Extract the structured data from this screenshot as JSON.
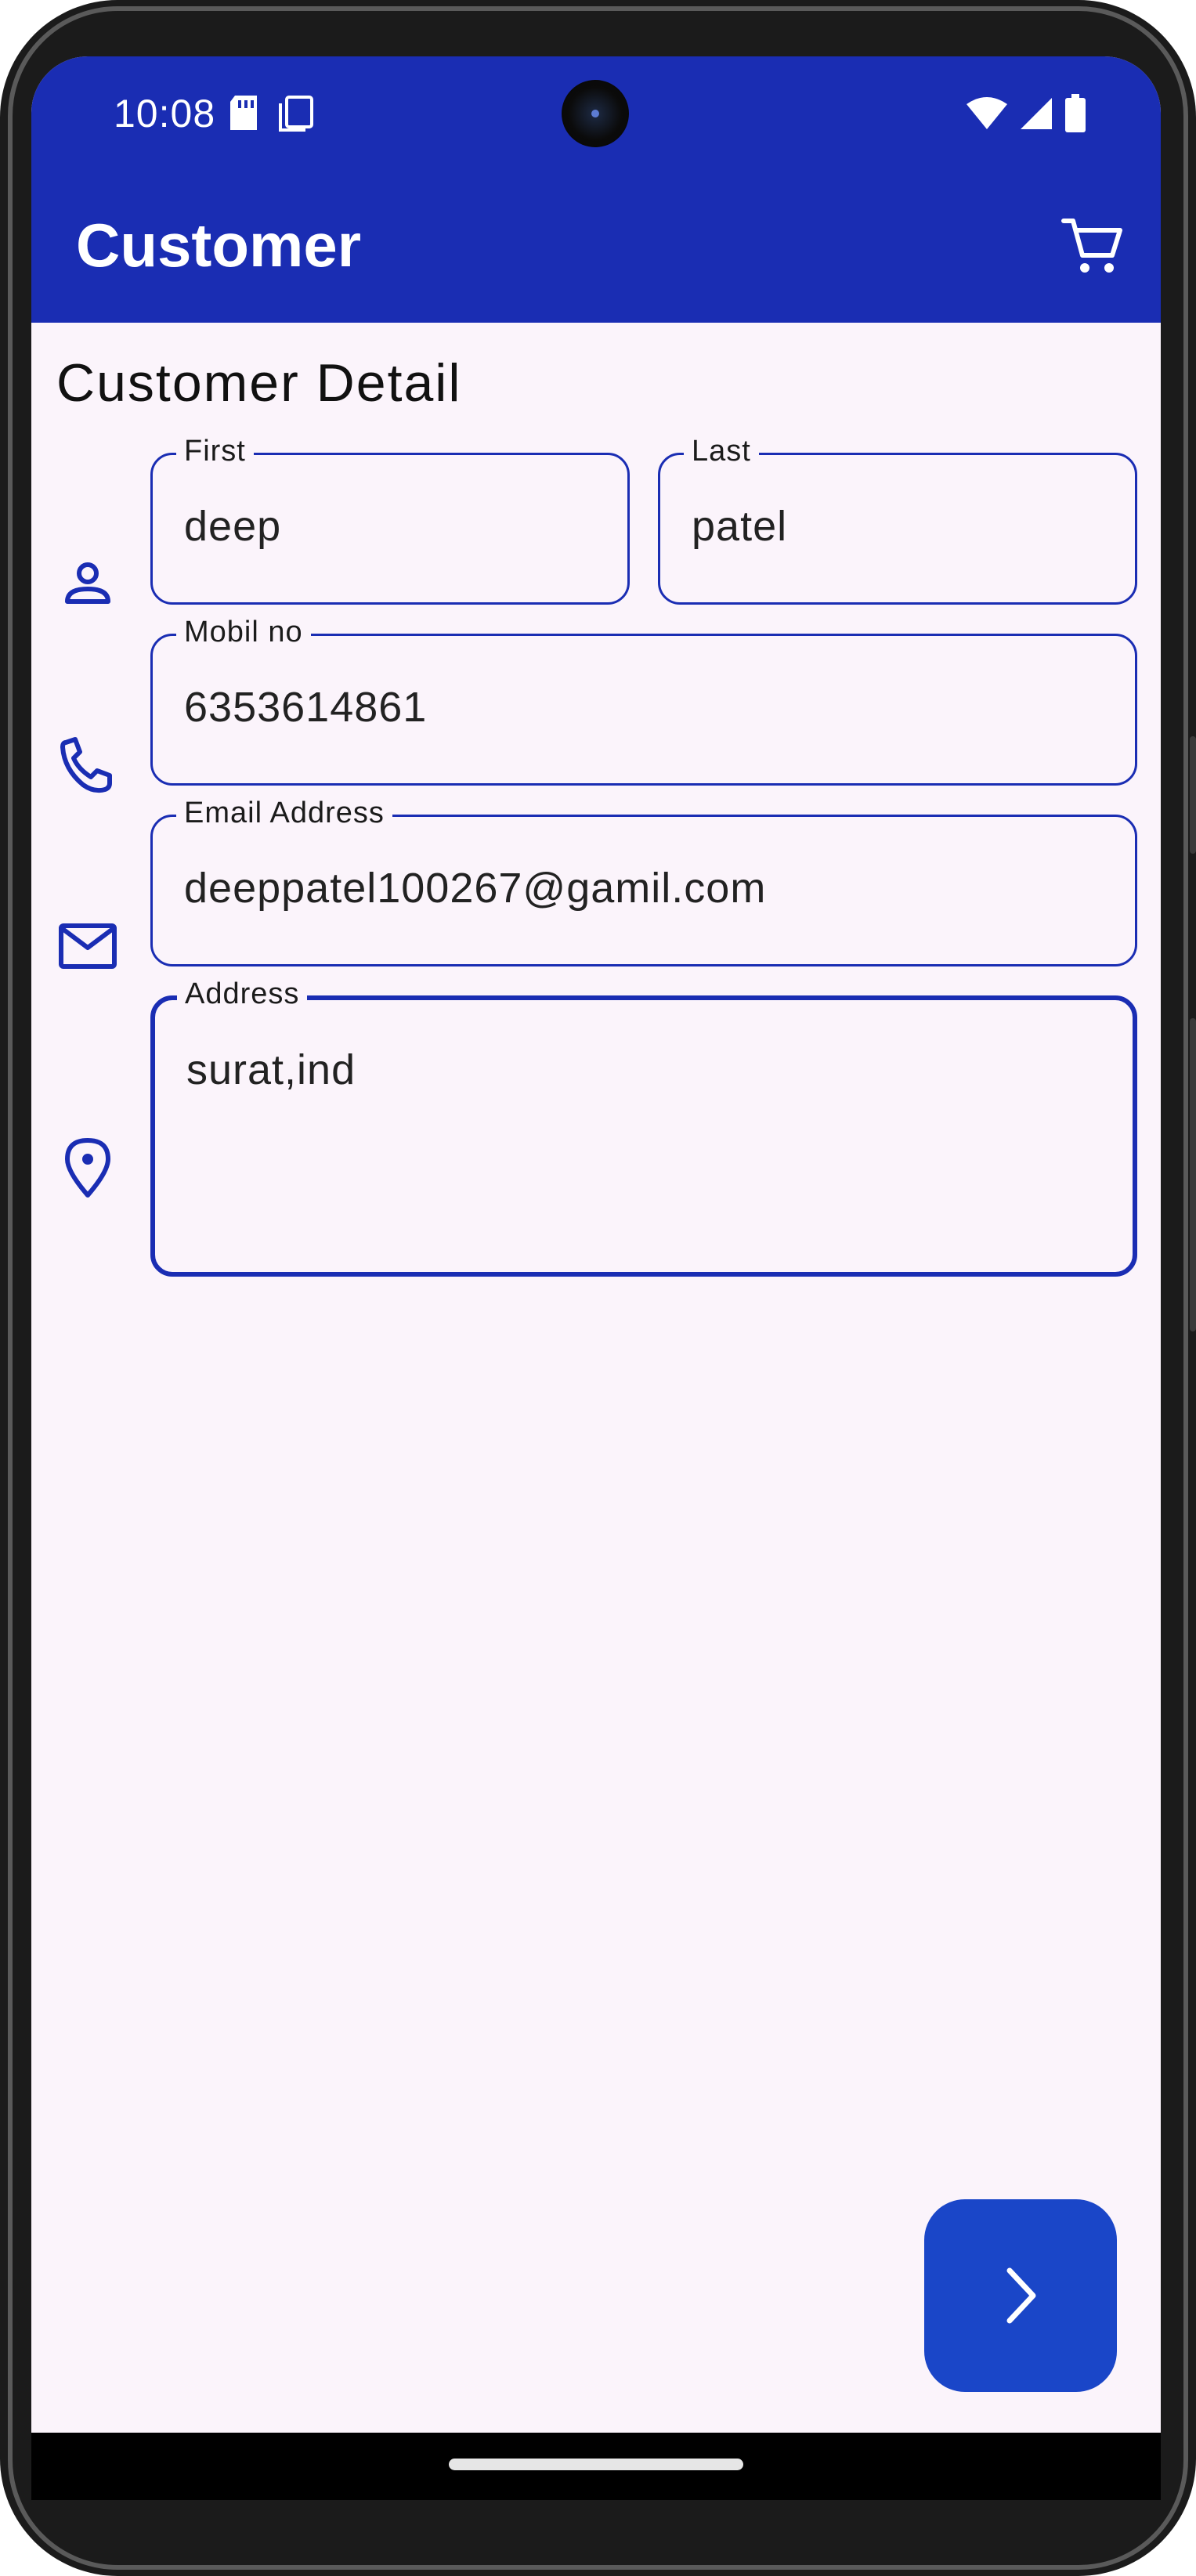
{
  "status_bar": {
    "time": "10:08",
    "left_icons": [
      "sd-card-icon",
      "screenshot-icon"
    ],
    "right_icons": [
      "wifi-icon",
      "signal-icon",
      "battery-icon"
    ]
  },
  "app_bar": {
    "title": "Customer",
    "action_icon": "cart-icon",
    "background": "#1a2db3"
  },
  "section_title": "Customer Detail",
  "fields": {
    "first": {
      "label": "First",
      "value": "deep",
      "icon": "person-icon"
    },
    "last": {
      "label": "Last",
      "value": "patel"
    },
    "mobile": {
      "label": "Mobil no",
      "value": "6353614861",
      "icon": "phone-icon"
    },
    "email": {
      "label": "Email Address",
      "value": "deeppatel100267@gamil.com",
      "icon": "mail-icon"
    },
    "address": {
      "label": "Address",
      "value": "surat,ind",
      "icon": "location-pin-icon",
      "focused": true
    }
  },
  "fab": {
    "icon": "chevron-right-icon",
    "color": "#1a46c8"
  },
  "colors": {
    "accent": "#1a2db3",
    "surface": "#fbf4fb"
  }
}
